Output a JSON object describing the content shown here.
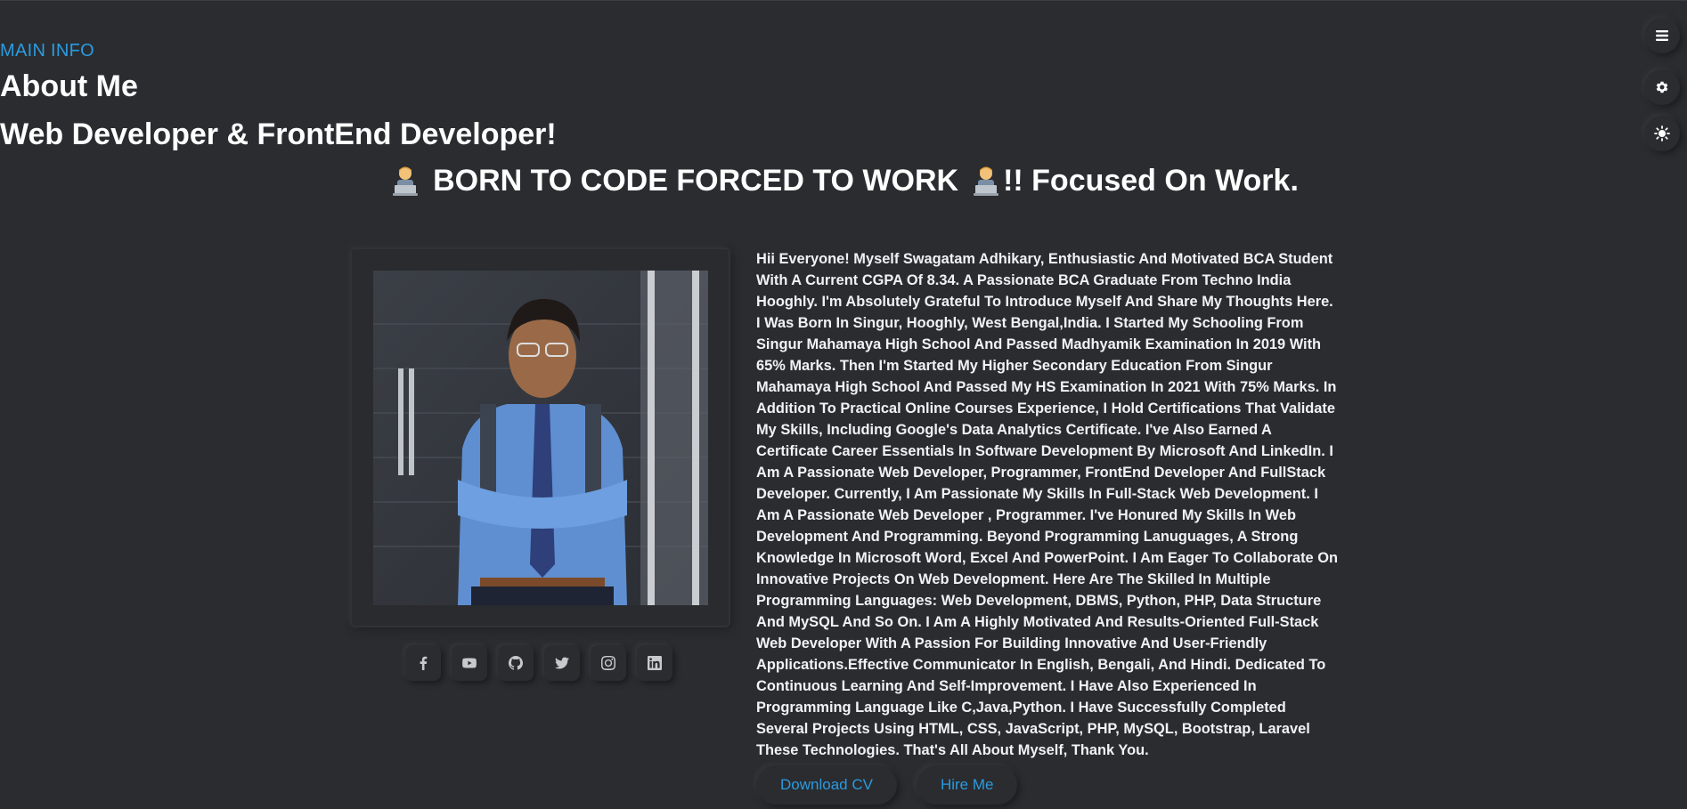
{
  "header": {
    "kicker": "MAIN INFO",
    "title": "About Me",
    "subtitle": "Web Developer & FrontEnd Developer!",
    "motto_part1": "BORN TO CODE FORCED TO WORK",
    "motto_part2": "!! Focused On Work."
  },
  "about": {
    "paragraph": "Hii Everyone! Myself Swagatam Adhikary, Enthusiastic And Motivated BCA Student With A Current CGPA Of 8.34. A Passionate BCA Graduate From Techno India Hooghly. I'm Absolutely Grateful To Introduce Myself And Share My Thoughts Here. I Was Born In Singur, Hooghly, West Bengal,India. I Started My Schooling From Singur Mahamaya High School And Passed Madhyamik Examination In 2019 With 65% Marks. Then I'm Started My Higher Secondary Education From Singur Mahamaya High School And Passed My HS Examination In 2021 With 75% Marks. In Addition To Practical Online Courses Experience, I Hold Certifications That Validate My Skills, Including Google's Data Analytics Certificate. I've Also Earned A Certificate Career Essentials In Software Development By Microsoft And LinkedIn. I Am A Passionate Web Developer, Programmer, FrontEnd Developer And FullStack Developer. Currently, I Am Passionate My Skills In Full-Stack Web Development. I Am A Passionate Web Developer , Programmer. I've Honured My Skills In Web Development And Programming. Beyond Programming Lanuguages, A Strong Knowledge In Microsoft Word, Excel And PowerPoint. I Am Eager To Collaborate On Innovative Projects On Web Development. Here Are The Skilled In Multiple Programming Languages: Web Development, DBMS, Python, PHP, Data Structure And MySQL And So On. I Am A Highly Motivated And Results-Oriented Full-Stack Web Developer With A Passion For Building Innovative And User-Friendly Applications.Effective Communicator In English, Bengali, And Hindi. Dedicated To Continuous Learning And Self-Improvement. I Have Also Experienced In Programming Language Like C,Java,Python. I Have Successfully Completed Several Projects Using HTML, CSS, JavaScript, PHP, MySQL, Bootstrap, Laravel These Technologies. That's All About Myself, Thank You."
  },
  "social": [
    "facebook-icon",
    "youtube-icon",
    "github-icon",
    "twitter-icon",
    "instagram-icon",
    "linkedin-icon"
  ],
  "buttons": {
    "download_cv": "Download CV",
    "hire_me": "Hire Me"
  },
  "side_controls": [
    "menu-icon",
    "settings-gear-icon",
    "theme-toggle-icon"
  ],
  "colors": {
    "background": "#2a2c30",
    "accent": "#2b9be0",
    "text": "#ffffff"
  }
}
